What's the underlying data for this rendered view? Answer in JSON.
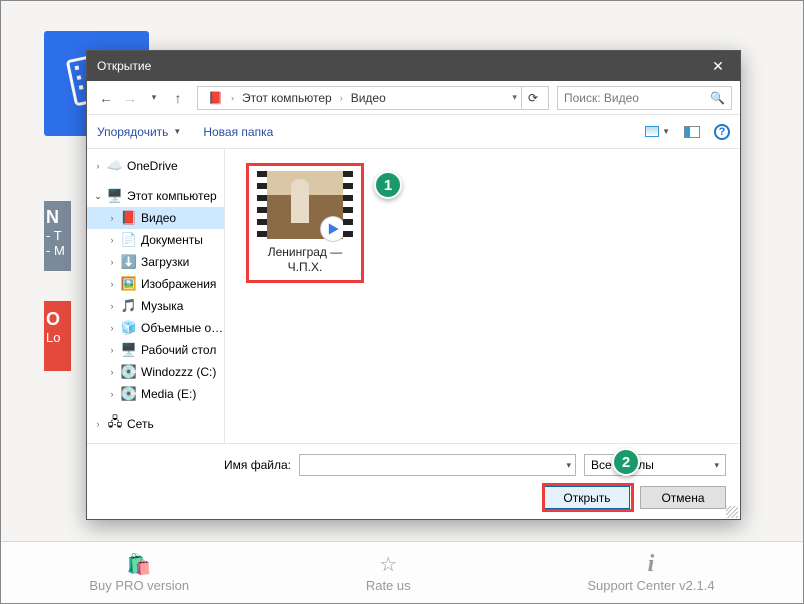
{
  "bg": {
    "n": "N",
    "t": "- T",
    "m": "- M",
    "o": "O",
    "lo": "Lo"
  },
  "dialog": {
    "title": "Открытие",
    "nav": {
      "root": "Этот компьютер",
      "folder": "Видео",
      "search_placeholder": "Поиск: Видео"
    },
    "toolbar": {
      "organize": "Упорядочить",
      "new_folder": "Новая папка"
    },
    "tree": {
      "onedrive": "OneDrive",
      "this_pc": "Этот компьютер",
      "videos": "Видео",
      "documents": "Документы",
      "downloads": "Загрузки",
      "pictures": "Изображения",
      "music": "Музыка",
      "objects3d": "Объемные объ",
      "desktop": "Рабочий стол",
      "cdrive": "Windozzz (C:)",
      "edrive": "Media (E:)",
      "net": "Сеть"
    },
    "file": {
      "name_l1": "Ленинград —",
      "name_l2": "Ч.П.Х."
    },
    "footer": {
      "filename_label": "Имя файла:",
      "filename_value": "",
      "filter": "Все файлы",
      "open": "Открыть",
      "cancel": "Отмена"
    }
  },
  "bottombar": {
    "buy": "Buy PRO version",
    "rate": "Rate us",
    "support": "Support Center  v2.1.4"
  },
  "badges": {
    "one": "1",
    "two": "2"
  }
}
